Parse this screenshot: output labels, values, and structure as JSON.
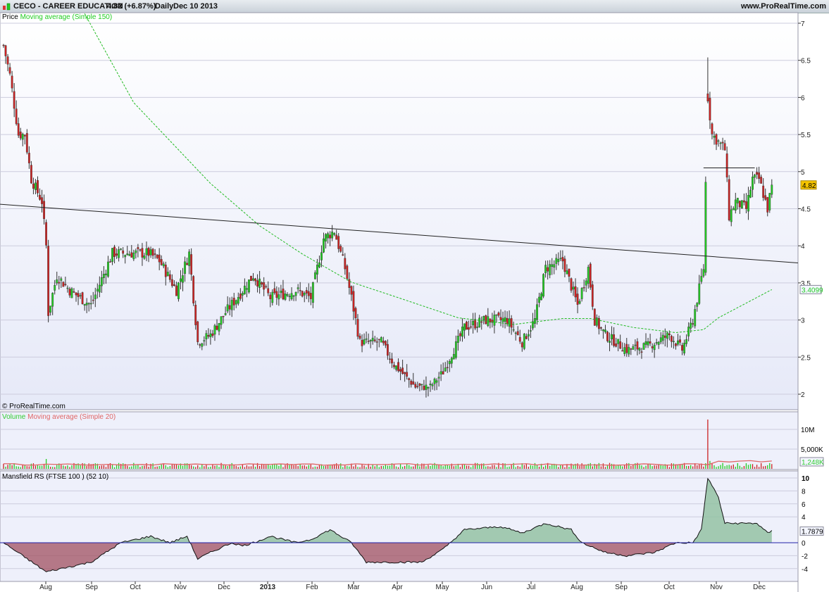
{
  "header": {
    "symbol": "CECO - CAREER EDUCATION",
    "quote": "4.82 (+6.87%)",
    "period": "Daily",
    "date": "Dec 10 2013",
    "site": "www.ProRealTime.com"
  },
  "panels": {
    "price_label": "Price",
    "ma_label": "Moving average (Simple 150)",
    "copyright": "© ProRealTime.com",
    "volume_label": "Volume",
    "vol_ma_label": "Moving average (Simple 20)",
    "rs_label": "Mansfield RS (FTSE 100 ) (52 10)"
  },
  "colors": {
    "up": "#22cc22",
    "down": "#cc2222",
    "ma": "#22bb22",
    "vol_ma": "#e06666",
    "rs_pos": "#8fbf9f",
    "rs_neg": "#a05060",
    "bg": "#eef0fb"
  },
  "chart_data": [
    {
      "type": "candlestick",
      "title": "CECO - CAREER EDUCATION",
      "ylim": [
        1.8,
        7.1
      ],
      "y_ticks": [
        "7",
        "6.5",
        "6",
        "5.5",
        "5",
        "4.5",
        "4",
        "3.5",
        "3",
        "2.5",
        "2"
      ],
      "x_ticks": [
        "Aug",
        "Sep",
        "Oct",
        "Nov",
        "Dec",
        "2013",
        "Feb",
        "Mar",
        "Apr",
        "May",
        "Jun",
        "Jul",
        "Aug",
        "Sep",
        "Oct",
        "Nov",
        "Dec"
      ],
      "last_price": "4.82",
      "ma_last": "3.4099",
      "close_path": [
        [
          0,
          6.7
        ],
        [
          3,
          6.3
        ],
        [
          7,
          5.5
        ],
        [
          10,
          5.5
        ],
        [
          13,
          4.9
        ],
        [
          18,
          4.6
        ],
        [
          20,
          4.0
        ],
        [
          21,
          3.1
        ],
        [
          25,
          3.6
        ],
        [
          31,
          3.4
        ],
        [
          41,
          3.2
        ],
        [
          51,
          3.9
        ],
        [
          59,
          3.9
        ],
        [
          68,
          3.9
        ],
        [
          73,
          3.8
        ],
        [
          81,
          3.4
        ],
        [
          87,
          3.9
        ],
        [
          91,
          2.7
        ],
        [
          97,
          2.8
        ],
        [
          104,
          3.1
        ],
        [
          112,
          3.4
        ],
        [
          117,
          3.6
        ],
        [
          125,
          3.3
        ],
        [
          137,
          3.4
        ],
        [
          144,
          3.3
        ],
        [
          150,
          4.1
        ],
        [
          155,
          4.2
        ],
        [
          160,
          3.7
        ],
        [
          163,
          3.3
        ],
        [
          167,
          2.7
        ],
        [
          177,
          2.7
        ],
        [
          183,
          2.4
        ],
        [
          193,
          2.1
        ],
        [
          200,
          2.1
        ],
        [
          206,
          2.3
        ],
        [
          216,
          2.9
        ],
        [
          226,
          3.0
        ],
        [
          236,
          3.0
        ],
        [
          243,
          2.7
        ],
        [
          249,
          3.0
        ],
        [
          254,
          3.7
        ],
        [
          262,
          3.8
        ],
        [
          269,
          3.2
        ],
        [
          274,
          3.7
        ],
        [
          277,
          3.0
        ],
        [
          282,
          2.8
        ],
        [
          292,
          2.6
        ],
        [
          302,
          2.65
        ],
        [
          312,
          2.8
        ],
        [
          318,
          2.6
        ],
        [
          323,
          3.0
        ],
        [
          328,
          3.7
        ],
        [
          330,
          6.0
        ],
        [
          332,
          5.5
        ],
        [
          335,
          5.4
        ],
        [
          338,
          5.3
        ],
        [
          340,
          4.4
        ],
        [
          343,
          4.6
        ],
        [
          348,
          4.5
        ],
        [
          351,
          4.9
        ],
        [
          354,
          4.9
        ],
        [
          358,
          4.5
        ],
        [
          360,
          4.82
        ]
      ],
      "ma150": [
        [
          38,
          7.13
        ],
        [
          61,
          5.93
        ],
        [
          97,
          4.84
        ],
        [
          120,
          4.27
        ],
        [
          140,
          3.89
        ],
        [
          163,
          3.51
        ],
        [
          183,
          3.32
        ],
        [
          213,
          3.03
        ],
        [
          239,
          2.94
        ],
        [
          262,
          3.02
        ],
        [
          275,
          3.02
        ],
        [
          295,
          2.9
        ],
        [
          315,
          2.83
        ],
        [
          328,
          2.87
        ],
        [
          335,
          3.03
        ],
        [
          360,
          3.41
        ]
      ],
      "trendline": [
        [
          -1.6,
          4.56
        ],
        [
          372,
          3.77
        ]
      ],
      "resistance": [
        [
          328,
          5.05
        ],
        [
          352,
          5.05
        ]
      ]
    },
    {
      "type": "bar",
      "title": "Volume",
      "y_ticks": [
        "10M",
        "5,000K"
      ],
      "last": "1,248K",
      "typical_volume_m": 1.0,
      "spikes": [
        [
          20,
          2.5
        ],
        [
          330,
          12.5
        ],
        [
          331,
          2.0
        ]
      ]
    },
    {
      "type": "area",
      "title": "Mansfield RS",
      "y_ticks": [
        "10",
        "8",
        "6",
        "4",
        "0",
        "-2",
        "-4"
      ],
      "last": "1.7879",
      "values": [
        [
          0,
          0
        ],
        [
          20,
          -4.5
        ],
        [
          41,
          -3
        ],
        [
          55,
          0
        ],
        [
          69,
          1
        ],
        [
          78,
          0
        ],
        [
          86,
          1
        ],
        [
          91,
          -2.5
        ],
        [
          97,
          -1.5
        ],
        [
          107,
          0
        ],
        [
          112,
          -0.5
        ],
        [
          117,
          0
        ],
        [
          125,
          1
        ],
        [
          137,
          0
        ],
        [
          144,
          0.5
        ],
        [
          153,
          2
        ],
        [
          163,
          0
        ],
        [
          170,
          -3
        ],
        [
          183,
          -3
        ],
        [
          196,
          -3
        ],
        [
          206,
          -1
        ],
        [
          216,
          2
        ],
        [
          233,
          2.5
        ],
        [
          243,
          1.5
        ],
        [
          254,
          3
        ],
        [
          266,
          2
        ],
        [
          271,
          0
        ],
        [
          282,
          -1.5
        ],
        [
          292,
          -2
        ],
        [
          305,
          -1.5
        ],
        [
          315,
          0
        ],
        [
          323,
          0
        ],
        [
          327,
          2
        ],
        [
          330,
          10
        ],
        [
          335,
          7
        ],
        [
          338,
          3
        ],
        [
          348,
          3
        ],
        [
          353,
          3
        ],
        [
          358,
          1.5
        ],
        [
          360,
          1.79
        ]
      ]
    }
  ]
}
